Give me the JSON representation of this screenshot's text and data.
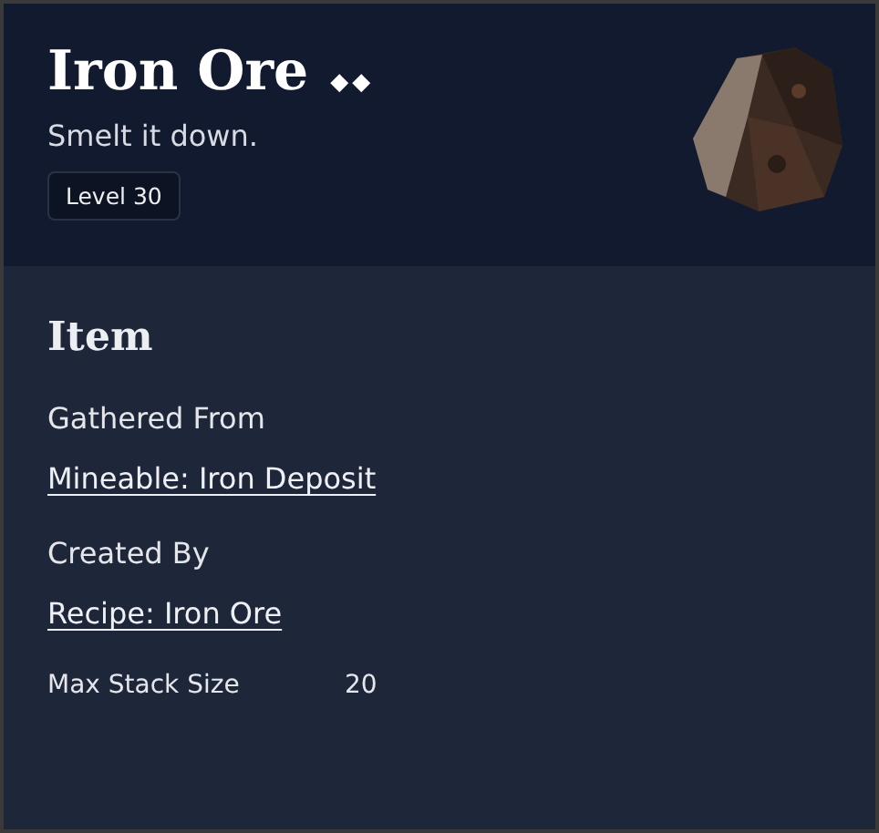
{
  "header": {
    "title": "Iron Ore",
    "rarity": "◆◆",
    "subtitle": "Smelt it down.",
    "level_badge": "Level 30"
  },
  "section": {
    "title": "Item",
    "groups": [
      {
        "label": "Gathered From",
        "links": [
          "Mineable: Iron Deposit"
        ]
      },
      {
        "label": "Created By",
        "links": [
          "Recipe: Iron Ore"
        ]
      }
    ],
    "stats": [
      {
        "label": "Max Stack Size",
        "value": "20"
      }
    ]
  }
}
